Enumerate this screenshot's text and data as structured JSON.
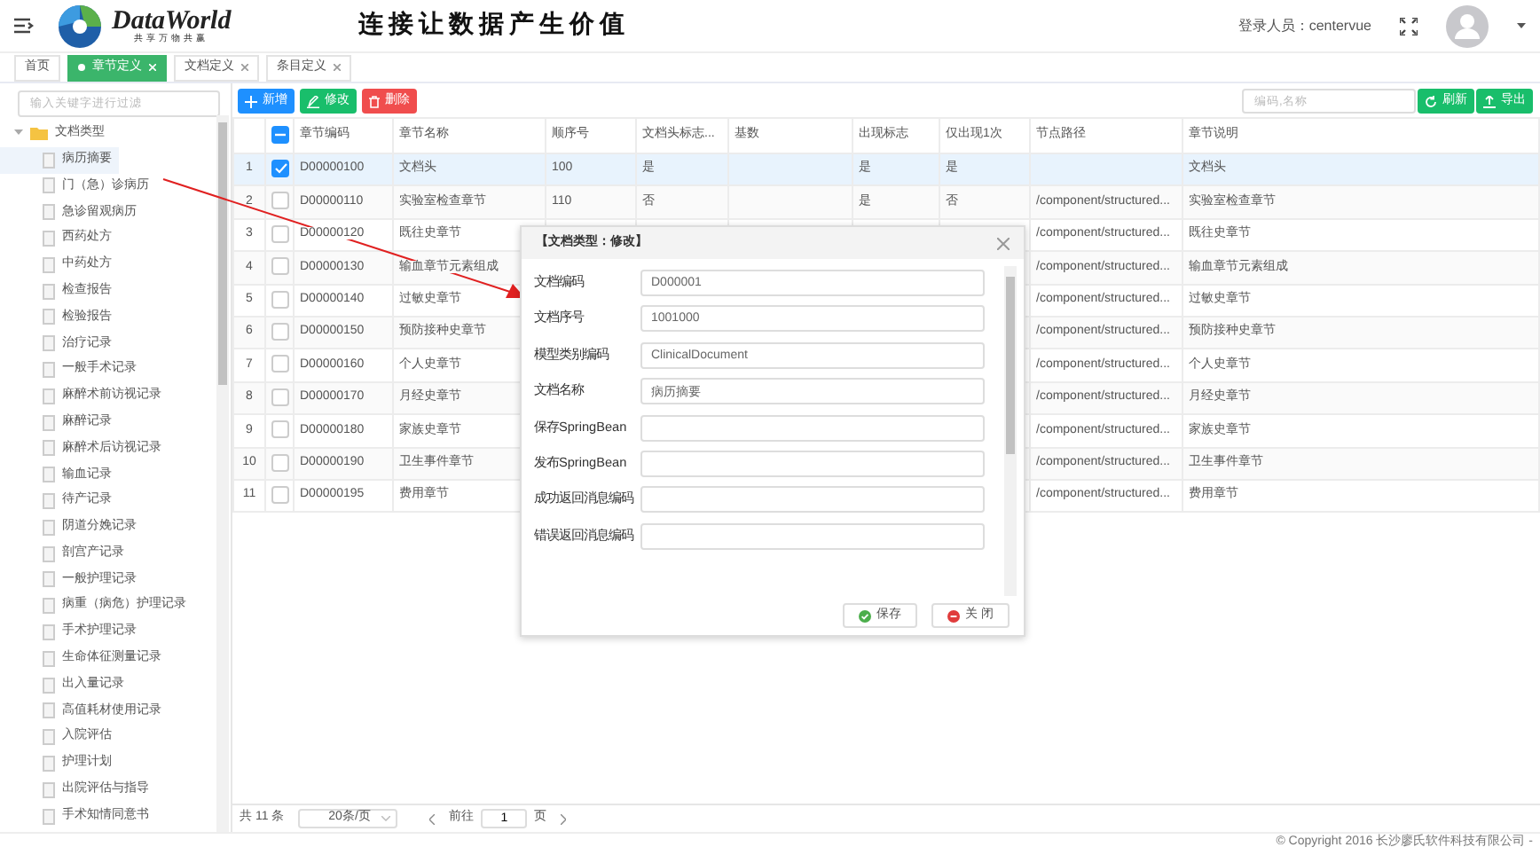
{
  "header": {
    "brand": "DataWorld",
    "brand_tagline": "共享万物共赢",
    "slogan": "连接让数据产生价值",
    "user_label": "登录人员：centervue"
  },
  "tabs": [
    {
      "label": "首页",
      "selected": false,
      "closable": false
    },
    {
      "label": "章节定义",
      "selected": true,
      "closable": true
    },
    {
      "label": "文档定义",
      "selected": false,
      "closable": true
    },
    {
      "label": "条目定义",
      "selected": false,
      "closable": true
    }
  ],
  "sidebar": {
    "filter_placeholder": "输入关键字进行过滤",
    "tree": {
      "label": "文档类型",
      "expanded": true,
      "children": [
        {
          "label": "病历摘要",
          "selected": true
        },
        {
          "label": "门（急）诊病历",
          "selected": false
        },
        {
          "label": "急诊留观病历",
          "selected": false
        },
        {
          "label": "西药处方",
          "selected": false
        },
        {
          "label": "中药处方",
          "selected": false
        },
        {
          "label": "检查报告",
          "selected": false
        },
        {
          "label": "检验报告",
          "selected": false
        },
        {
          "label": "治疗记录",
          "selected": false
        },
        {
          "label": "一般手术记录",
          "selected": false
        },
        {
          "label": "麻醉术前访视记录",
          "selected": false
        },
        {
          "label": "麻醉记录",
          "selected": false
        },
        {
          "label": "麻醉术后访视记录",
          "selected": false
        },
        {
          "label": "输血记录",
          "selected": false
        },
        {
          "label": "待产记录",
          "selected": false
        },
        {
          "label": "阴道分娩记录",
          "selected": false
        },
        {
          "label": "剖宫产记录",
          "selected": false
        },
        {
          "label": "一般护理记录",
          "selected": false
        },
        {
          "label": "病重（病危）护理记录",
          "selected": false
        },
        {
          "label": "手术护理记录",
          "selected": false
        },
        {
          "label": "生命体征测量记录",
          "selected": false
        },
        {
          "label": "出入量记录",
          "selected": false
        },
        {
          "label": "高值耗材使用记录",
          "selected": false
        },
        {
          "label": "入院评估",
          "selected": false
        },
        {
          "label": "护理计划",
          "selected": false
        },
        {
          "label": "出院评估与指导",
          "selected": false
        },
        {
          "label": "手术知情同意书",
          "selected": false
        }
      ]
    }
  },
  "toolbar": {
    "buttons": [
      {
        "label": "新增",
        "kind": "add"
      },
      {
        "label": "修改",
        "kind": "edit"
      },
      {
        "label": "删除",
        "kind": "delete"
      }
    ],
    "search_placeholder": "编码,名称",
    "actions": [
      {
        "label": "刷新",
        "kind": "refresh"
      },
      {
        "label": "导出",
        "kind": "export"
      }
    ]
  },
  "table": {
    "select_all_partial": true,
    "columns": [
      "章节编码",
      "章节名称",
      "顺序号",
      "文档头标志...",
      "基数",
      "出现标志",
      "仅出现1次",
      "节点路径",
      "章节说明"
    ],
    "rows": [
      {
        "index": "1",
        "checked": true,
        "selected": true,
        "cells": [
          "D00000100",
          "文档头",
          "100",
          "是",
          null,
          "是",
          "是",
          null,
          "文档头"
        ]
      },
      {
        "index": "2",
        "checked": false,
        "selected": false,
        "cells": [
          "D00000110",
          "实验室检查章节",
          "110",
          "否",
          null,
          "是",
          "否",
          "/component/structured...",
          "实验室检查章节"
        ]
      },
      {
        "index": "3",
        "checked": false,
        "selected": false,
        "cells": [
          "D00000120",
          "既往史章节",
          null,
          null,
          null,
          null,
          null,
          "/component/structured...",
          "既往史章节"
        ]
      },
      {
        "index": "4",
        "checked": false,
        "selected": false,
        "cells": [
          "D00000130",
          "输血章节元素组成",
          null,
          null,
          null,
          null,
          null,
          "/component/structured...",
          "输血章节元素组成"
        ]
      },
      {
        "index": "5",
        "checked": false,
        "selected": false,
        "cells": [
          "D00000140",
          "过敏史章节",
          null,
          null,
          null,
          null,
          null,
          "/component/structured...",
          "过敏史章节"
        ]
      },
      {
        "index": "6",
        "checked": false,
        "selected": false,
        "cells": [
          "D00000150",
          "预防接种史章节",
          null,
          null,
          null,
          null,
          null,
          "/component/structured...",
          "预防接种史章节"
        ]
      },
      {
        "index": "7",
        "checked": false,
        "selected": false,
        "cells": [
          "D00000160",
          "个人史章节",
          null,
          null,
          null,
          null,
          null,
          "/component/structured...",
          "个人史章节"
        ]
      },
      {
        "index": "8",
        "checked": false,
        "selected": false,
        "cells": [
          "D00000170",
          "月经史章节",
          null,
          null,
          null,
          null,
          null,
          "/component/structured...",
          "月经史章节"
        ]
      },
      {
        "index": "9",
        "checked": false,
        "selected": false,
        "cells": [
          "D00000180",
          "家族史章节",
          null,
          null,
          null,
          null,
          null,
          "/component/structured...",
          "家族史章节"
        ]
      },
      {
        "index": "10",
        "checked": false,
        "selected": false,
        "cells": [
          "D00000190",
          "卫生事件章节",
          null,
          null,
          null,
          null,
          null,
          "/component/structured...",
          "卫生事件章节"
        ]
      },
      {
        "index": "11",
        "checked": false,
        "selected": false,
        "cells": [
          "D00000195",
          "费用章节",
          null,
          null,
          null,
          null,
          null,
          "/component/structured...",
          "费用章节"
        ]
      }
    ]
  },
  "pager": {
    "total": "共 11 条",
    "page_size": "20条/页",
    "goto_label": "前往",
    "page": "1",
    "page_suffix": "页"
  },
  "dialog": {
    "title": "【文档类型：修改】",
    "fields": [
      {
        "label": "文档编码",
        "value": "D000001"
      },
      {
        "label": "文档序号",
        "value": "1001000"
      },
      {
        "label": "模型类别编码",
        "value": "ClinicalDocument"
      },
      {
        "label": "文档名称",
        "value": "病历摘要"
      },
      {
        "label": "保存SpringBean"
      },
      {
        "label": "发布SpringBean"
      },
      {
        "label": "成功返回消息编码"
      },
      {
        "label": "错误返回消息编码"
      }
    ],
    "buttons": [
      {
        "label": "保存",
        "kind": "save"
      },
      {
        "label": "关 闭",
        "kind": "close"
      }
    ]
  },
  "footer": {
    "copyright": "© Copyright 2016 长沙廖氏软件科技有限公司 -"
  }
}
